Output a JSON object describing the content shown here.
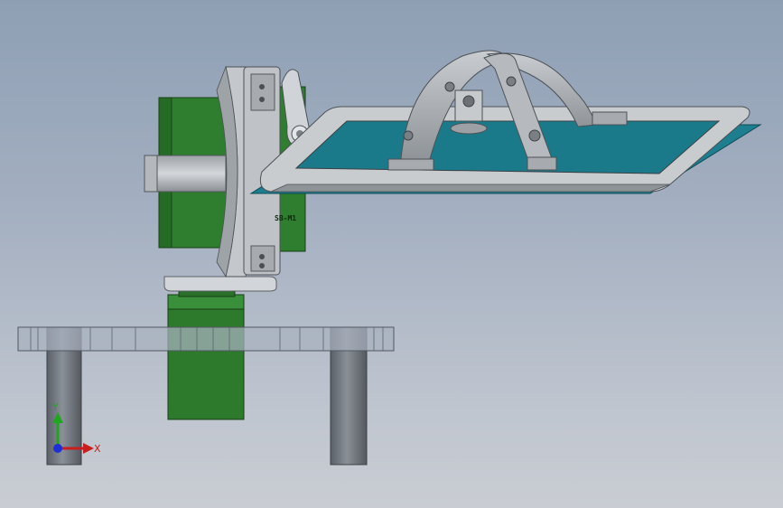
{
  "scene": {
    "colors": {
      "background_top": "#8e9fb4",
      "background_bottom": "#c9cdd3",
      "servo_green": "#2e7d2e",
      "servo_green_dark": "#1f5a1f",
      "metal_grey": "#b8bcc2",
      "metal_dark": "#6e7378",
      "pcb_teal": "#1a7a8a",
      "plate_glass": "#9aa6b5"
    },
    "parts": {
      "servo_text": "SB-M1"
    },
    "triad": {
      "y_label": "Y",
      "x_label": "X",
      "y_color": "#1fa81f",
      "x_color": "#c81e1e",
      "z_color": "#1e2fd8"
    }
  }
}
